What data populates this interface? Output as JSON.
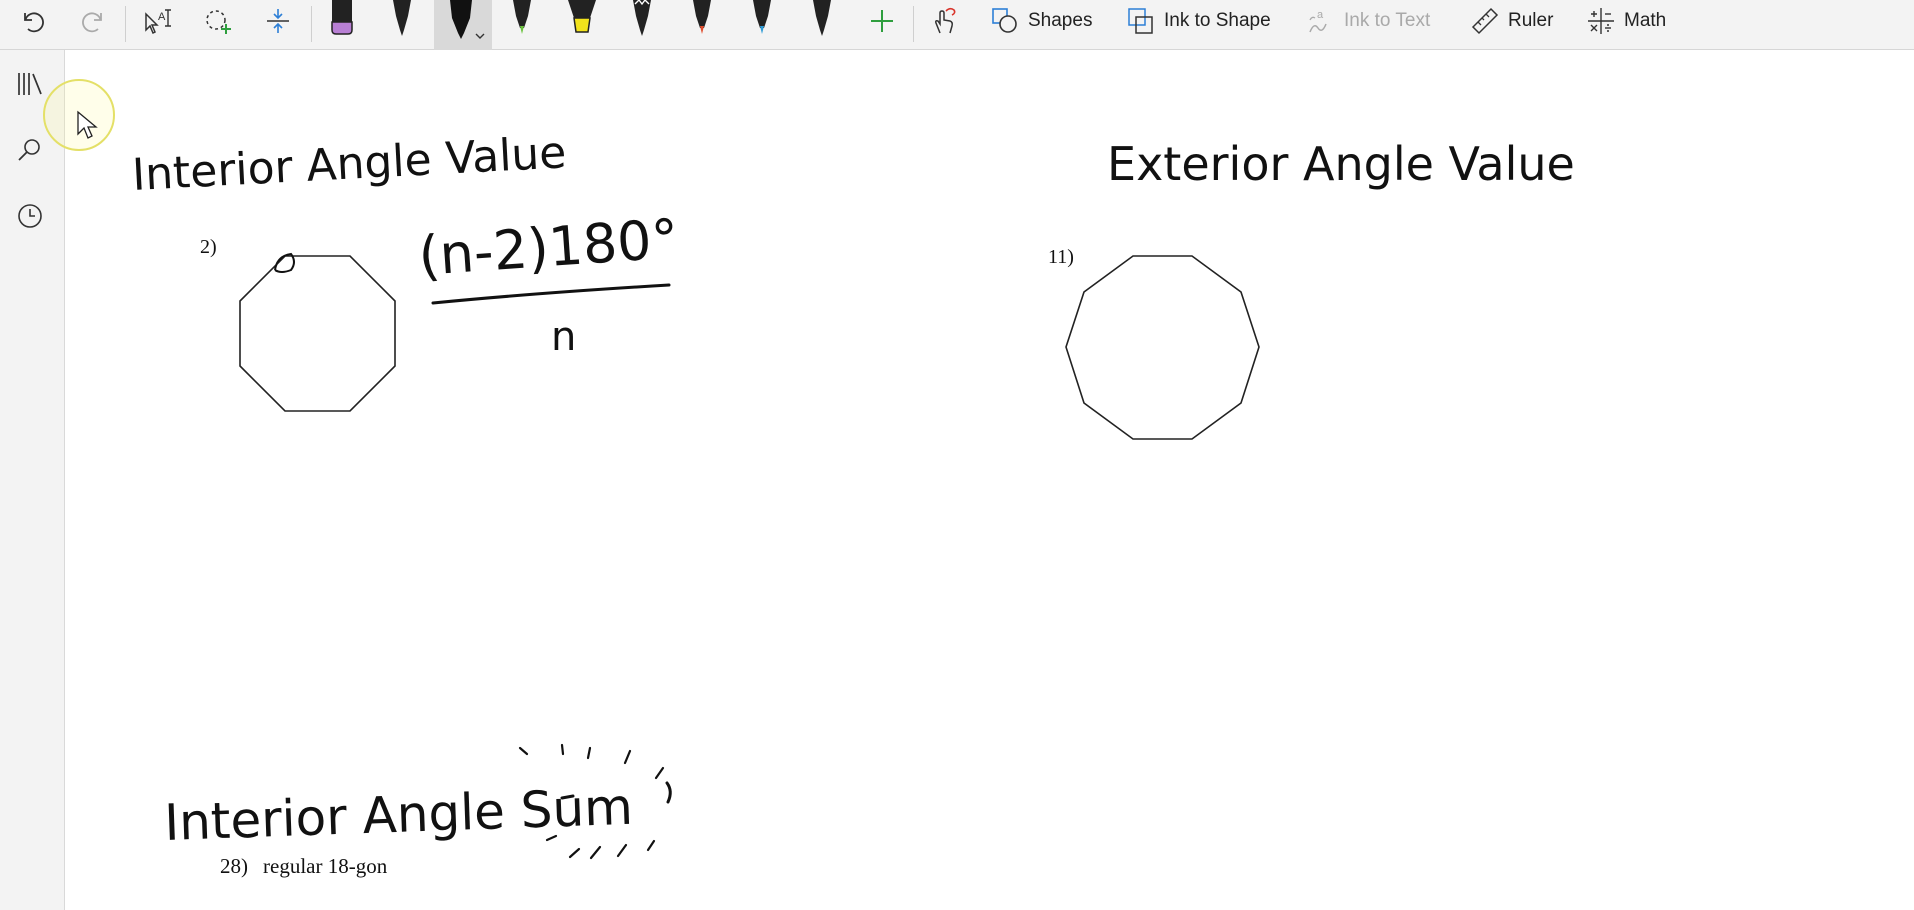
{
  "toolbar": {
    "tools": {
      "undo": "undo-icon",
      "redo": "redo-icon",
      "select_text": "select-text-icon",
      "lasso": "lasso-select-icon",
      "insert_space": "insert-space-icon",
      "touch_draw": "touch-draw-icon"
    },
    "pens": [
      {
        "name": "pen-purple-highlighter",
        "color": "#b87fd4"
      },
      {
        "name": "pen-black-fine",
        "color": "#111111"
      },
      {
        "name": "pen-black-marker",
        "color": "#111111",
        "selected": true
      },
      {
        "name": "pen-green",
        "color": "#69c23b"
      },
      {
        "name": "pen-yellow-highlighter",
        "color": "#f2e31c"
      },
      {
        "name": "pen-galaxy",
        "color": "#444444"
      },
      {
        "name": "pen-red",
        "color": "#e04c2c"
      },
      {
        "name": "pen-blue",
        "color": "#2d9bd6"
      },
      {
        "name": "pen-black-thin",
        "color": "#111111"
      }
    ],
    "add_pen_icon": "plus-icon",
    "shapes_label": "Shapes",
    "ink_to_shape_label": "Ink to Shape",
    "ink_to_text_label": "Ink to Text",
    "ruler_label": "Ruler",
    "math_label": "Math"
  },
  "sidebar": {
    "items": [
      {
        "name": "notebooks",
        "icon": "library-icon"
      },
      {
        "name": "search",
        "icon": "search-icon"
      },
      {
        "name": "recent",
        "icon": "clock-icon"
      }
    ]
  },
  "canvas": {
    "handwriting": {
      "interior_title": "Interior Angle Value",
      "formula_numerator": "(n-2)180°",
      "formula_denominator": "n",
      "exterior_title": "Exterior Angle Value",
      "sum_title": "Interior Angle Sum"
    },
    "problems": [
      {
        "label": "2)",
        "shape": "octagon"
      },
      {
        "label": "11)",
        "shape": "decagon"
      },
      {
        "label": "28)",
        "text": "regular 18-gon"
      }
    ]
  },
  "colors": {
    "toolbar_bg": "#f3f3f3",
    "ink": "#111111",
    "accent_green": "#2e9e3e",
    "cursor_ring": "#e4e067"
  }
}
